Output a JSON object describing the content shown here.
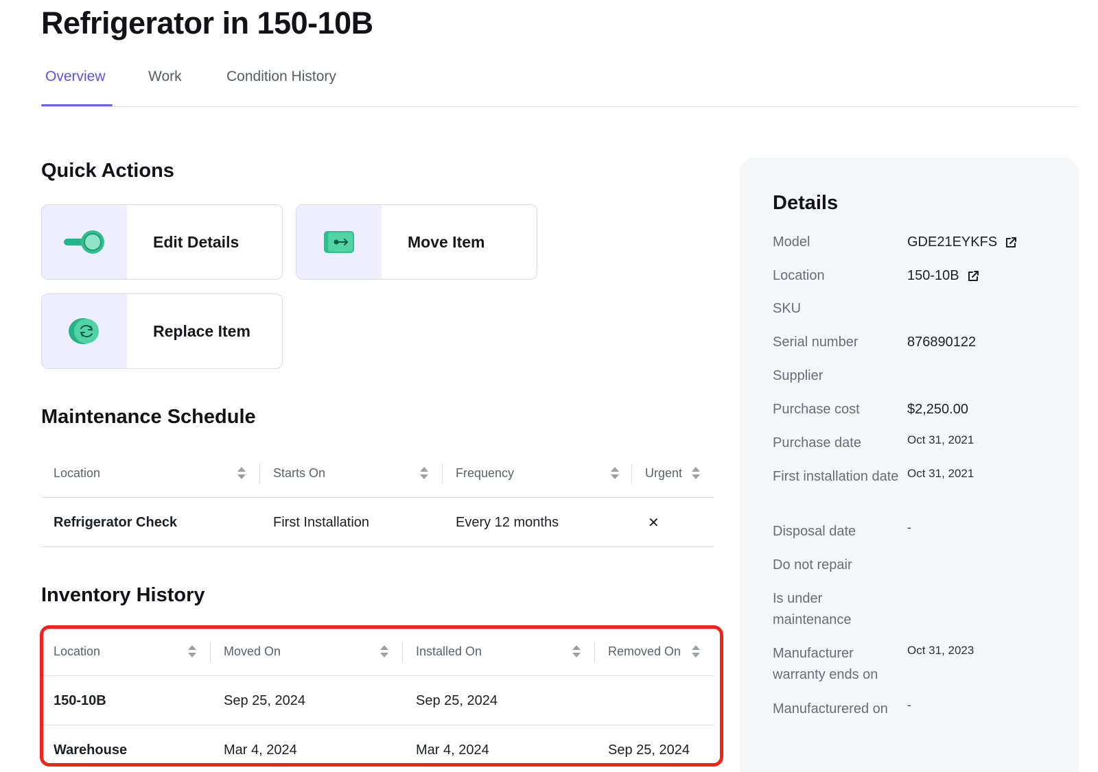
{
  "page": {
    "title": "Refrigerator in 150-10B"
  },
  "tabs": [
    {
      "label": "Overview",
      "active": true
    },
    {
      "label": "Work",
      "active": false
    },
    {
      "label": "Condition History",
      "active": false
    }
  ],
  "quick_actions": {
    "title": "Quick Actions",
    "items": [
      {
        "label": "Edit Details",
        "icon": "toggle-icon"
      },
      {
        "label": "Move Item",
        "icon": "move-arrow-icon"
      },
      {
        "label": "Replace Item",
        "icon": "refresh-icon"
      }
    ]
  },
  "maintenance": {
    "title": "Maintenance Schedule",
    "columns": [
      "Location",
      "Starts On",
      "Frequency",
      "Urgent"
    ],
    "rows": [
      {
        "location": "Refrigerator Check",
        "starts_on": "First Installation",
        "frequency": "Every 12 months",
        "urgent": "✕"
      }
    ]
  },
  "inventory": {
    "title": "Inventory History",
    "columns": [
      "Location",
      "Moved On",
      "Installed On",
      "Removed On"
    ],
    "rows": [
      {
        "location": "150-10B",
        "moved_on": "Sep 25, 2024",
        "installed_on": "Sep 25, 2024",
        "removed_on": ""
      },
      {
        "location": "Warehouse",
        "moved_on": "Mar 4, 2024",
        "installed_on": "Mar 4, 2024",
        "removed_on": "Sep 25, 2024"
      }
    ]
  },
  "details": {
    "title": "Details",
    "fields": [
      {
        "label": "Model",
        "value": "GDE21EYKFS"
      },
      {
        "label": "Location",
        "value": "150-10B"
      },
      {
        "label": "SKU",
        "value": ""
      },
      {
        "label": "Serial number",
        "value": "876890122"
      },
      {
        "label": "Supplier",
        "value": ""
      },
      {
        "label": "Purchase cost",
        "value": "$2,250.00"
      },
      {
        "label": "Purchase date",
        "value": "Oct 31, 2021"
      },
      {
        "label": "First installation date",
        "value": "Oct 31, 2021"
      },
      {
        "label": "Disposal date",
        "value": "-"
      },
      {
        "label": "Do not repair",
        "value": ""
      },
      {
        "label": "Is under maintenance",
        "value": ""
      },
      {
        "label": "Manufacturer warranty ends on",
        "value": "Oct 31, 2023"
      },
      {
        "label": "Manufacturered on",
        "value": "-"
      }
    ]
  },
  "colors": {
    "accent": "#5b54e8",
    "highlight": "#f2231b",
    "icon_green": "#2fbf8f",
    "icon_bg": "#efeefe"
  }
}
